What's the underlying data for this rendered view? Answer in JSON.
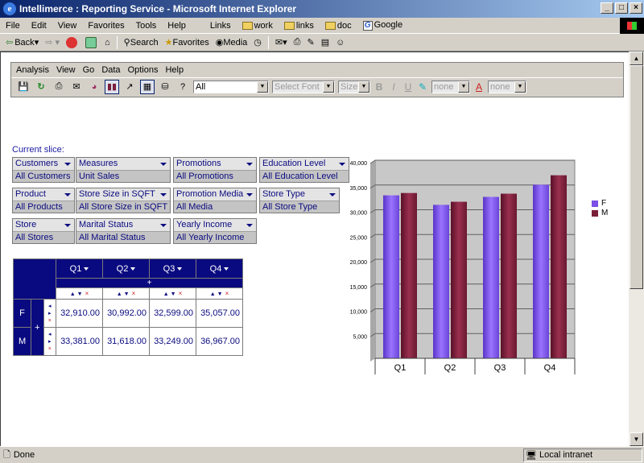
{
  "window": {
    "title": "Intellimerce : Reporting Service - Microsoft Internet Explorer"
  },
  "ie_menu": [
    "File",
    "Edit",
    "View",
    "Favorites",
    "Tools",
    "Help"
  ],
  "ie_links": {
    "label": "Links",
    "items": [
      "work",
      "links",
      "doc",
      "Google"
    ]
  },
  "ie_toolbar": {
    "back": "Back",
    "search": "Search",
    "favorites": "Favorites",
    "media": "Media"
  },
  "app_menu": [
    "Analysis",
    "View",
    "Go",
    "Data",
    "Options",
    "Help"
  ],
  "app_toolbar": {
    "view_select": "All",
    "font_select": "Select Font",
    "size_select": "Size",
    "bold": "B",
    "italic": "I",
    "underline": "U",
    "bg_color": "none",
    "font_color_glyph": "A",
    "fg_color": "none"
  },
  "slice": {
    "label": "Current slice:",
    "slicers": [
      {
        "name": "Customers",
        "value": "All Customers"
      },
      {
        "name": "Measures",
        "value": "Unit Sales"
      },
      {
        "name": "Promotions",
        "value": "All Promotions"
      },
      {
        "name": "Education Level",
        "value": "All Education Level"
      },
      {
        "name": "Product",
        "value": "All Products"
      },
      {
        "name": "Store Size in SQFT",
        "value": "All Store Size in SQFT"
      },
      {
        "name": "Promotion Media",
        "value": "All Media"
      },
      {
        "name": "Store Type",
        "value": "All Store Type"
      },
      {
        "name": "Store",
        "value": "All Stores"
      },
      {
        "name": "Marital Status",
        "value": "All Marital Status"
      },
      {
        "name": "Yearly Income",
        "value": "All Yearly Income"
      }
    ]
  },
  "pivot": {
    "columns": [
      "Q1",
      "Q2",
      "Q3",
      "Q4"
    ],
    "expand_glyph": "+",
    "rows": [
      {
        "label": "F",
        "cells": [
          "32,910.00",
          "30,992.00",
          "32,599.00",
          "35,057.00"
        ]
      },
      {
        "label": "M",
        "cells": [
          "33,381.00",
          "31,618.00",
          "33,249.00",
          "36,967.00"
        ]
      }
    ]
  },
  "chart_data": {
    "type": "bar",
    "categories": [
      "Q1",
      "Q2",
      "Q3",
      "Q4"
    ],
    "series": [
      {
        "name": "F",
        "values": [
          32910,
          30992,
          32599,
          35057
        ],
        "color": "#7b4fe6"
      },
      {
        "name": "M",
        "values": [
          33381,
          31618,
          33249,
          36967
        ],
        "color": "#7a1f3a"
      }
    ],
    "ylim": [
      0,
      40000
    ],
    "yticks": [
      "5,000",
      "10,000",
      "15,000",
      "20,000",
      "25,000",
      "30,000",
      "35,000",
      "40,000"
    ],
    "grid": true,
    "legend": "top-right"
  },
  "status": {
    "text": "Done",
    "zone": "Local intranet"
  }
}
